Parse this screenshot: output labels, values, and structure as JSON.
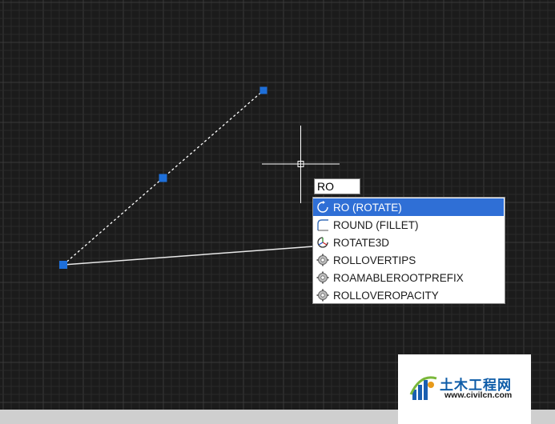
{
  "command_input": {
    "value": "RO"
  },
  "suggestions": [
    {
      "label": "RO (ROTATE)",
      "icon": "rotate-icon",
      "selected": true
    },
    {
      "label": "ROUND (FILLET)",
      "icon": "fillet-icon",
      "selected": false
    },
    {
      "label": "ROTATE3D",
      "icon": "rotate3d-icon",
      "selected": false
    },
    {
      "label": "ROLLOVERTIPS",
      "icon": "gear-icon",
      "selected": false
    },
    {
      "label": "ROAMABLEROOTPREFIX",
      "icon": "gear-icon",
      "selected": false
    },
    {
      "label": "ROLLOVEROPACITY",
      "icon": "gear-icon",
      "selected": false
    }
  ],
  "watermark": {
    "title": "土木工程网",
    "url": "www.civilcn.com"
  },
  "colors": {
    "background": "#1b1b1b",
    "grid_minor": "#2a2a2a",
    "grid_major": "#3a3a3a",
    "grip": "#1e6fd9",
    "selection_highlight": "#2f6fd6",
    "crosshair": "#ffffff"
  }
}
